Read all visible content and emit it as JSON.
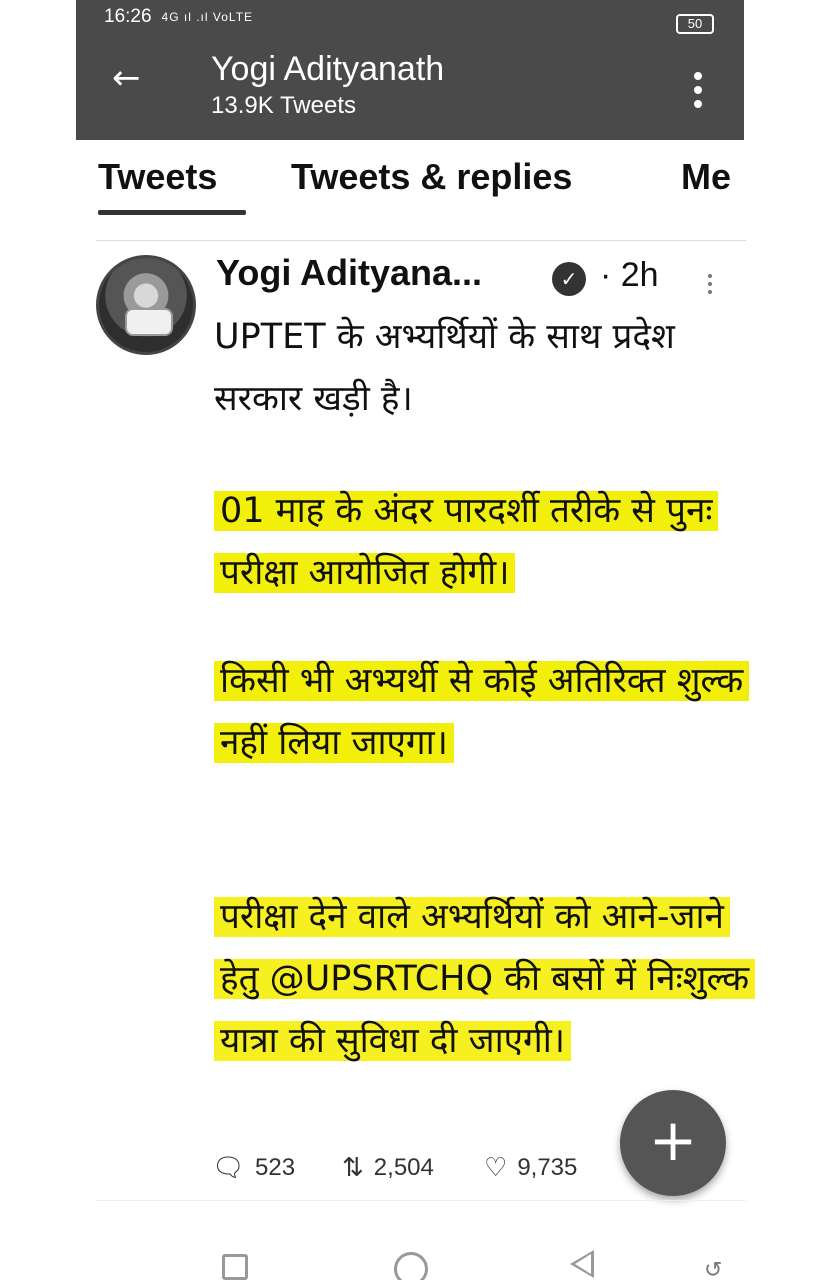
{
  "status_bar": {
    "time": "16:26",
    "signal_text": "4G ıl .ıl VoLTE",
    "battery": "50"
  },
  "header": {
    "title": "Yogi Adityanath",
    "subtitle": "13.9K Tweets",
    "back_icon": "arrow-left-icon",
    "more_icon": "kebab-vertical-icon"
  },
  "tabs": [
    {
      "label": "Tweets",
      "active": true
    },
    {
      "label": "Tweets & replies",
      "active": false
    },
    {
      "label": "Me",
      "active": false
    }
  ],
  "tweet": {
    "author": "Yogi Adityana...",
    "verified": true,
    "time": "· 2h",
    "paragraphs": [
      "UPTET के अभ्यर्थियों के साथ प्रदेश सरकार खड़ी है।",
      "01 माह के अंदर पारदर्शी तरीके से पुनः परीक्षा आयोजित होगी।",
      "किसी भी अभ्यर्थी से कोई अतिरिक्त शुल्क नहीं लिया जाएगा।",
      "परीक्षा देने वाले अभ्यर्थियों को आने-जाने हेतु @UPSRTCHQ की बसों में निःशुल्क यात्रा की सुविधा दी जाएगी।"
    ],
    "highlight_color": "#f2f00a",
    "reply_count": "523",
    "retweet_count": "2,504",
    "like_count": "9,735"
  },
  "fab": {
    "label": "+"
  }
}
